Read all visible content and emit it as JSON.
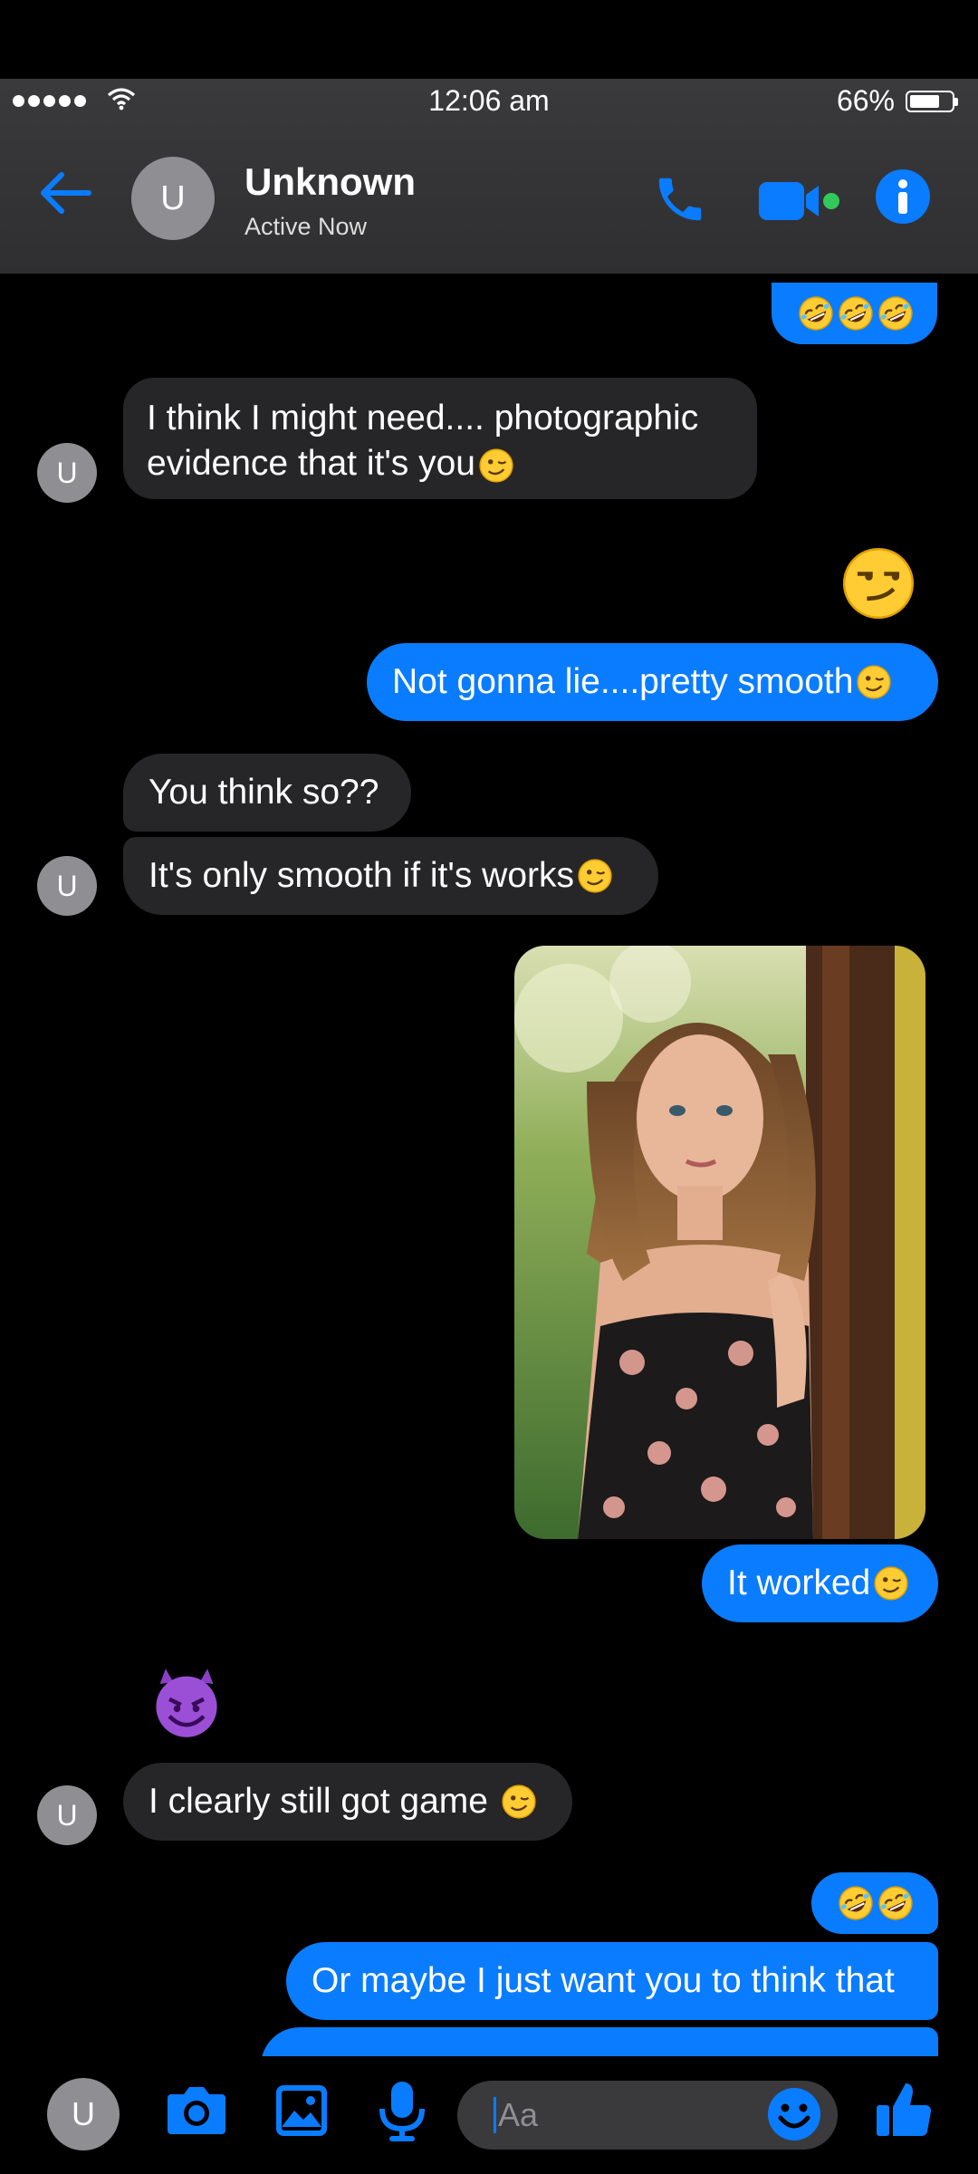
{
  "status_bar": {
    "time": "12:06 am",
    "battery": "66%"
  },
  "header": {
    "avatar_initial": "U",
    "contact_name": "Unknown",
    "contact_status": "Active Now"
  },
  "messages": [
    {
      "side": "out",
      "text": ""
    },
    {
      "side": "in",
      "line1": "I think I might need.... photographic",
      "line2": "evidence that it's you"
    },
    {
      "side": "out",
      "text": "Not gonna lie....pretty smooth"
    },
    {
      "side": "in",
      "text": "You think so??"
    },
    {
      "side": "in",
      "text": "It's only smooth if it's works"
    },
    {
      "side": "out",
      "text": "It worked"
    },
    {
      "side": "in",
      "text": "I clearly still got game "
    },
    {
      "side": "out",
      "text": ""
    },
    {
      "side": "out",
      "text": "Or maybe I just want you to think that"
    }
  ],
  "avatar_initial": "U",
  "composer": {
    "avatar_initial": "U",
    "placeholder": "Aa"
  },
  "colors": {
    "accent": "#0a7cff",
    "incoming_bubble": "#262628",
    "header": "#333335",
    "avatar": "#8e8e93"
  },
  "icons": [
    "back-arrow-icon",
    "phone-icon",
    "video-camera-icon",
    "info-icon",
    "camera-icon",
    "gallery-icon",
    "microphone-icon",
    "emoji-icon",
    "thumbs-up-icon"
  ]
}
